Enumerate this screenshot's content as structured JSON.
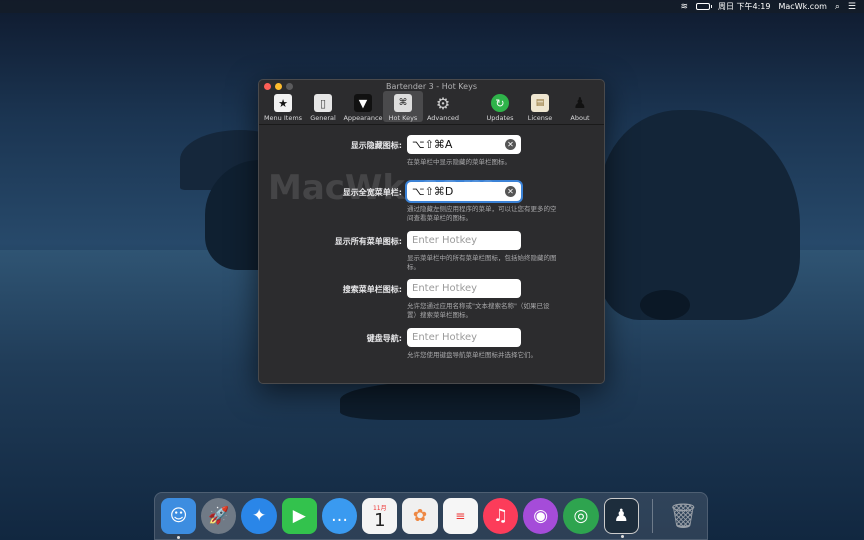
{
  "menubar": {
    "clock": "周日 下午4:19",
    "site": "MacWk.com"
  },
  "window": {
    "title": "Bartender 3 - Hot Keys",
    "toolbar": [
      {
        "label": "Menu Items",
        "icon": "star-icon",
        "active": false
      },
      {
        "label": "General",
        "icon": "switch-icon",
        "active": false
      },
      {
        "label": "Appearance",
        "icon": "tuxedo-icon",
        "active": false
      },
      {
        "label": "Hot Keys",
        "icon": "keys-icon",
        "active": true
      },
      {
        "label": "Advanced",
        "icon": "gear-icon",
        "active": false
      },
      {
        "label": "Updates",
        "icon": "refresh-icon",
        "active": false
      },
      {
        "label": "License",
        "icon": "certificate-icon",
        "active": false
      },
      {
        "label": "About",
        "icon": "bartender-icon",
        "active": false
      }
    ],
    "rows": [
      {
        "label": "显示隐藏图标:",
        "value": "⌥⇧⌘A",
        "desc": "在菜单栏中显示隐藏的菜单栏图标。"
      },
      {
        "label": "显示全宽菜单栏:",
        "value": "⌥⇧⌘D",
        "desc": "通过隐藏左侧应用程序的菜单，可以让您有更多的空间查看菜单栏的图标。"
      },
      {
        "label": "显示所有菜单图标:",
        "value": "",
        "placeholder": "Enter Hotkey",
        "desc": "显示菜单栏中的所有菜单栏图标，包括始终隐藏的图标。"
      },
      {
        "label": "搜索菜单栏图标:",
        "value": "",
        "placeholder": "Enter Hotkey",
        "desc": "允许您通过应用名称或\"文本搜索名称\"（如果已设置）搜索菜单栏图标。"
      },
      {
        "label": "键盘导航:",
        "value": "",
        "placeholder": "Enter Hotkey",
        "desc": "允许您使用键盘导航菜单栏图标并选择它们。"
      }
    ]
  },
  "watermark": "MacWk.com",
  "dock": {
    "calendar_month": "11月",
    "calendar_day": "1",
    "apps": [
      {
        "name": "finder-icon",
        "color": "#3d8de0"
      },
      {
        "name": "launchpad-icon",
        "color": "#707a86"
      },
      {
        "name": "safari-icon",
        "color": "#2a86e8"
      },
      {
        "name": "facetime-icon",
        "color": "#33c24d"
      },
      {
        "name": "messages-icon",
        "color": "#3a9af0"
      },
      {
        "name": "calendar-icon",
        "color": "#f4f4f4"
      },
      {
        "name": "photos-icon",
        "color": "#f0f0f0"
      },
      {
        "name": "reminders-icon",
        "color": "#f6f6f6"
      },
      {
        "name": "music-icon",
        "color": "#fc3c5a"
      },
      {
        "name": "podcasts-icon",
        "color": "#a54cd9"
      },
      {
        "name": "find-my-icon",
        "color": "#2ea44f"
      },
      {
        "name": "bartender-icon",
        "color": "#1d2d3c"
      },
      {
        "name": "trash-icon",
        "color": "#8a8f96"
      }
    ]
  }
}
